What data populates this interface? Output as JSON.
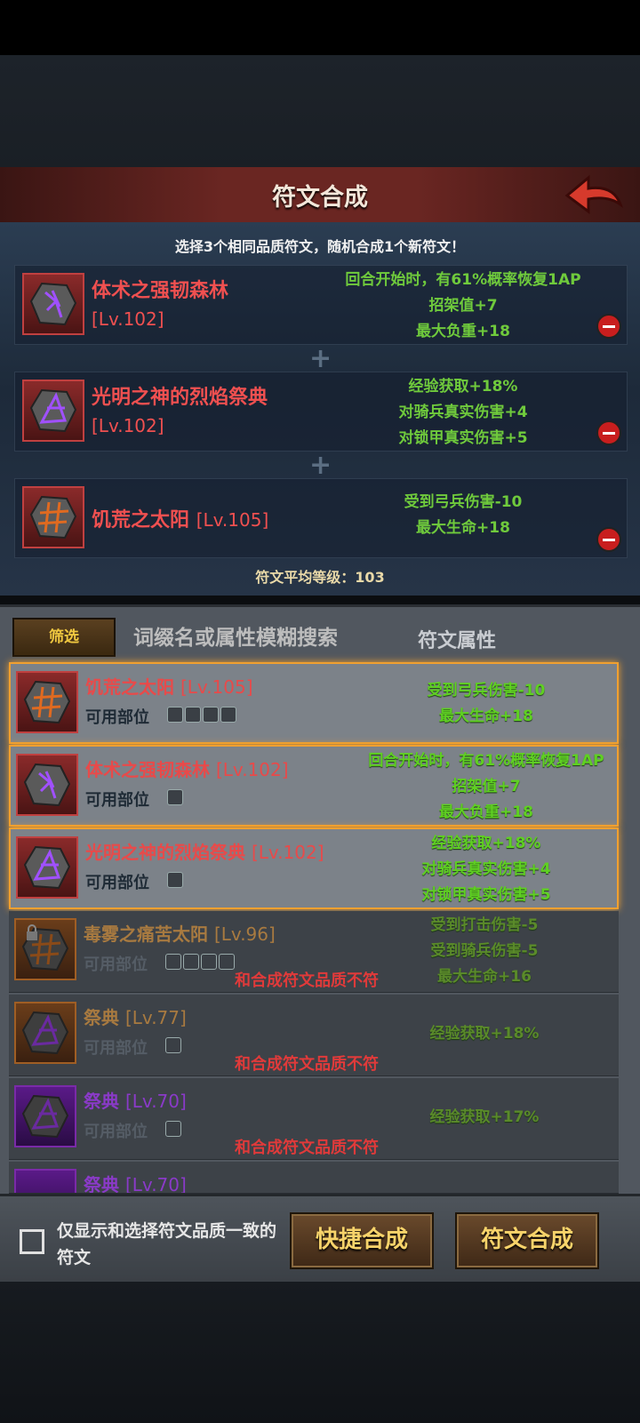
{
  "header": {
    "title": "符文合成"
  },
  "synth": {
    "hint": "选择3个相同品质符文，随机合成1个新符文！",
    "slots": [
      {
        "name": "体术之强韧森林",
        "level": "[Lv.102]",
        "attrs": [
          "回合开始时，有61%概率恢复1AP",
          "招架值+7",
          "最大负重+18"
        ]
      },
      {
        "name": "光明之神的烈焰祭典",
        "level": "[Lv.102]",
        "attrs": [
          "经验获取+18%",
          "对骑兵真实伤害+4",
          "对锁甲真实伤害+5"
        ]
      },
      {
        "name": "饥荒之太阳",
        "level": "[Lv.105]",
        "attrs": [
          "受到弓兵伤害-10",
          "最大生命+18"
        ]
      }
    ],
    "avg_label": "符文平均等级：103"
  },
  "list": {
    "filter_label": "筛选",
    "search_placeholder": "词缀名或属性模糊搜索",
    "attr_tab": "符文属性",
    "parts_label": "可用部位",
    "mismatch_text": "和合成符文品质不符",
    "rows": [
      {
        "name": "饥荒之太阳",
        "level": "[Lv.105]",
        "attrs": [
          "受到弓兵伤害-10",
          "最大生命+18"
        ]
      },
      {
        "name": "体术之强韧森林",
        "level": "[Lv.102]",
        "attrs": [
          "回合开始时，有61%概率恢复1AP",
          "招架值+7",
          "最大负重+18"
        ]
      },
      {
        "name": "光明之神的烈焰祭典",
        "level": "[Lv.102]",
        "attrs": [
          "经验获取+18%",
          "对骑兵真实伤害+4",
          "对锁甲真实伤害+5"
        ]
      },
      {
        "name": "毒雾之痛苦太阳",
        "level": "[Lv.96]",
        "attrs": [
          "受到打击伤害-5",
          "受到骑兵伤害-5",
          "最大生命+16"
        ]
      },
      {
        "name": "祭典",
        "level": "[Lv.77]",
        "attrs": [
          "经验获取+18%"
        ]
      },
      {
        "name": "祭典",
        "level": "[Lv.70]",
        "attrs": [
          "经验获取+17%"
        ]
      },
      {
        "name": "祭典",
        "level": "[Lv.70]"
      }
    ]
  },
  "bottom": {
    "checkbox_label": "仅显示和选择符文品质一致的符文",
    "quick_button": "快捷合成",
    "synth_button": "符文合成"
  },
  "colors": {
    "accent_red": "#e84a4a",
    "attr_green": "#5fd022",
    "button_gold": "#f7d36a",
    "select_orange": "#f0a030"
  }
}
